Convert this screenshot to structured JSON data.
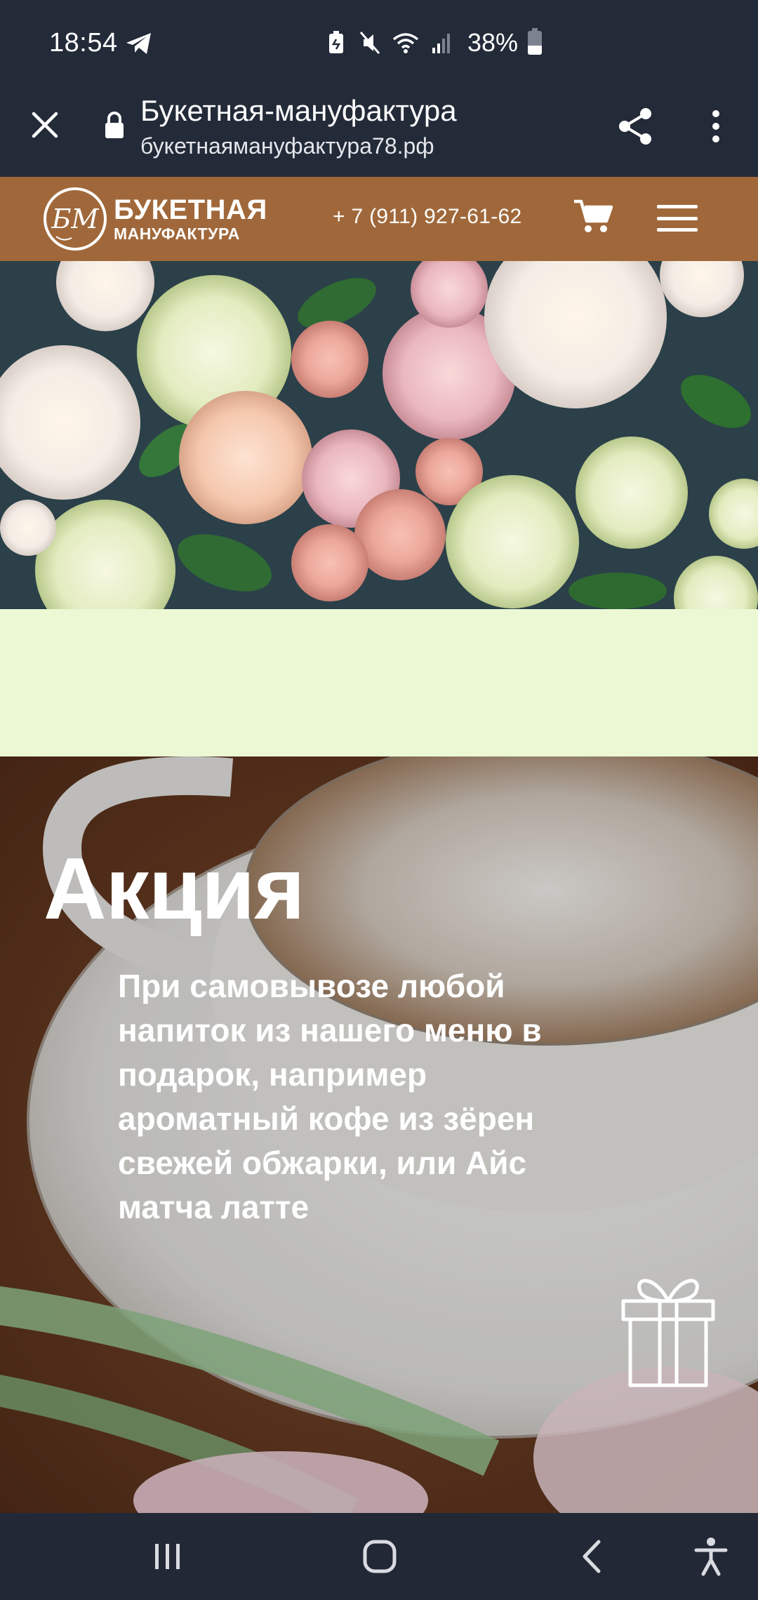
{
  "status_bar": {
    "time": "18:54",
    "battery": "38%",
    "battery_level": 0.38,
    "icons": [
      "telegram-icon",
      "battery-saver-icon",
      "mute-icon",
      "wifi-icon",
      "signal-icon",
      "battery-icon"
    ]
  },
  "browser_tab": {
    "title": "Букетная-мануфактура",
    "url": "букетнаямануфактура78.рф",
    "icons": [
      "close-icon",
      "lock-icon",
      "share-icon",
      "more-vert-icon"
    ]
  },
  "site_header": {
    "logo_monogram": "БМ",
    "logo_line1": "БУКЕТНАЯ",
    "logo_line2": "МАНУФАКТУРА",
    "phone": "+ 7 (911) 927-61-62",
    "icons": [
      "cart-icon",
      "hamburger-menu-icon"
    ],
    "background": "#a0683a"
  },
  "hero": {
    "image": "flowers-bouquet-photo"
  },
  "band": {
    "background": "#ecf8d4"
  },
  "promo": {
    "title": "Акция",
    "text": "При самовывозе любой напиток из нашего меню в подарок, например ароматный кофе из зёрен свежей обжарки, или Айс матча латте",
    "icon": "gift-icon",
    "image": "coffee-cup-photo"
  },
  "nav_bar": {
    "icons": [
      "recents-icon",
      "home-icon",
      "back-icon",
      "accessibility-icon"
    ]
  },
  "colors": {
    "system_bar": "#232a38",
    "brand_brown": "#a0683a",
    "text_white": "#ffffff"
  }
}
